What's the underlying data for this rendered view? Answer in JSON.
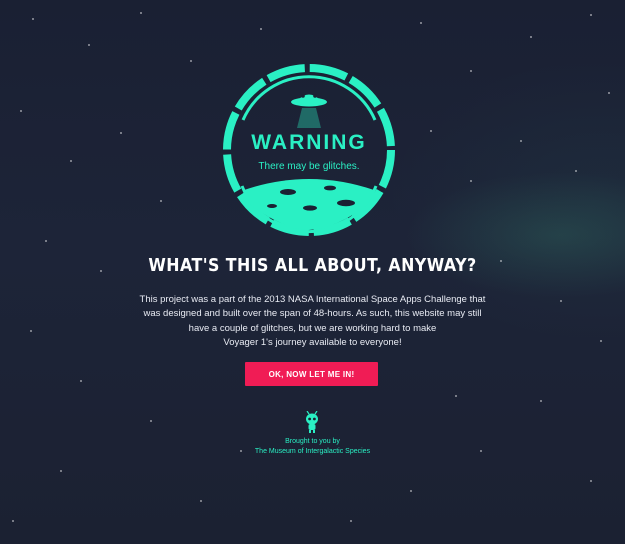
{
  "badge": {
    "word": "WARNING",
    "subtitle": "There may be glitches."
  },
  "intro": {
    "heading": "WHAT'S THIS ALL ABOUT, ANYWAY?",
    "lines": [
      "This project was a part of the 2013 NASA International Space Apps Challenge that",
      "was designed and built over the span of 48-hours. As such, this website may still",
      "have a couple of glitches, but we are working hard to make",
      "Voyager 1's journey available to everyone!"
    ]
  },
  "cta": {
    "label": "OK, NOW LET ME IN!"
  },
  "footer": {
    "icon": "alien-icon",
    "line1": "Brought to you by",
    "line2": "The Museum of Intergalactic Species"
  },
  "colors": {
    "background": "#1b2033",
    "accent": "#2af0c4",
    "button": "#f01c55",
    "text": "#ffffff"
  }
}
